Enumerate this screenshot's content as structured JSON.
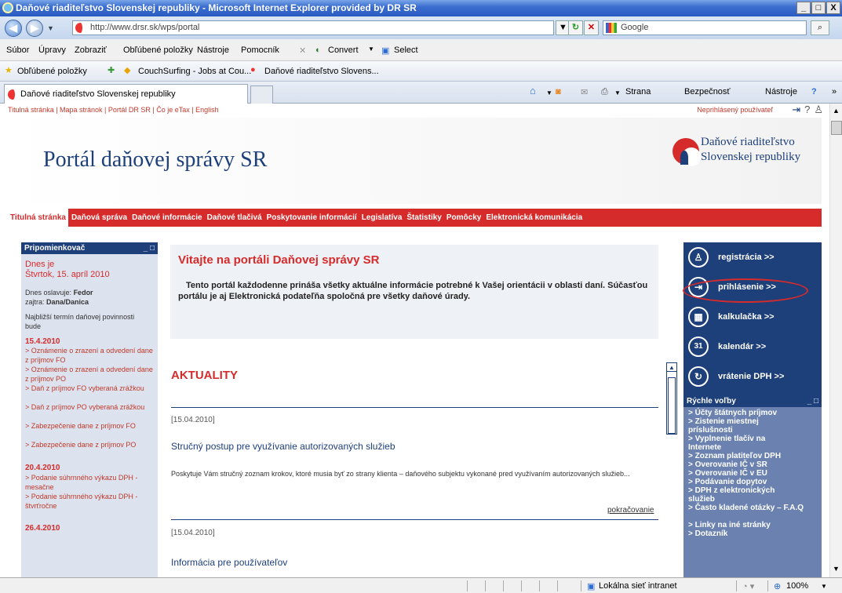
{
  "window": {
    "title": "Daňové riaditeľstvo Slovenskej republiky - Microsoft Internet Explorer provided by DR SR",
    "controls": [
      "_",
      "□",
      "X"
    ]
  },
  "address": {
    "url": "http://www.drsr.sk/wps/portal",
    "search_placeholder": "Google"
  },
  "menu": {
    "items": [
      "Súbor",
      "Úpravy",
      "Zobraziť",
      "Obľúbené položky",
      "Nástroje",
      "Pomocník"
    ],
    "convert": "Convert",
    "select": "Select"
  },
  "favorites": {
    "label": "Obľúbené položky",
    "links": [
      "CouchSurfing - Jobs at Cou...",
      "Daňové riaditeľstvo Slovens..."
    ]
  },
  "tab": {
    "title": "Daňové riaditeľstvo Slovenskej republiky"
  },
  "commands": [
    "Strana",
    "Bezpečnosť",
    "Nástroje"
  ],
  "page": {
    "toplinks": "Titulná stránka | Mapa stránok | Portál DR SR | Čo je eTax | English",
    "unsigned": "Neprihlásený používateľ",
    "portal_title": "Portál daňovej správy SR",
    "org_line1": "Daňové riaditeľstvo",
    "org_line2": "Slovenskej republiky",
    "nav": [
      "Titulná stránka",
      "Daňová správa",
      "Daňové informácie",
      "Daňové tlačivá",
      "Poskytovanie informácií",
      "Legislatíva",
      "Štatistiky",
      "Pomôcky",
      "Elektronická komunikácia"
    ],
    "left": {
      "header": "Pripomienkovač",
      "today": "Dnes je",
      "date": "Štvrtok, 15. apríl 2010",
      "namesday": "Dnes oslavuje:",
      "namesday_name": "Fedor",
      "tomorrow": "zajtra:",
      "tomorrow_name": "Dana/Danica",
      "deadline": "Najbližší termín daňovej povinnosti bude",
      "d1": "15.4.2010",
      "d1_items": [
        "> Oznámenie o zrazení a odvedení dane z príjmov FO",
        "> Oznámenie o zrazení a odvedení dane z príjmov PO",
        "> Daň z príjmov FO vyberaná zrážkou",
        "> Daň z príjmov PO vyberaná zrážkou",
        "> Zabezpečenie dane z príjmov FO",
        "> Zabezpečenie dane z príjmov PO"
      ],
      "d2": "20.4.2010",
      "d2_items": [
        "> Podanie súhrnného výkazu DPH - mesačne",
        "> Podanie súhrnného výkazu DPH - štvrťročne"
      ],
      "d3": "26.4.2010"
    },
    "welcome_title": "Vitajte na portáli Daňovej správy SR",
    "welcome_text": "Tento portál každodenne prináša všetky aktuálne informácie potrebné k Vašej orientácii v oblasti daní. Súčasťou portálu je aj Elektronická podateľňa spoločná pre všetky daňové úrady.",
    "news_heading": "AKTUALITY",
    "news": [
      {
        "date": "[15.04.2010]",
        "title": "Stručný postup pre využívanie autorizovaných služieb",
        "body": "Poskytuje Vám stručný zoznam krokov, ktoré musia byť zo strany klienta – daňového subjektu vykonané pred využívaním autorizovaných služieb...",
        "more": "pokračovanie"
      },
      {
        "date": "[15.04.2010]",
        "title": "Informácia pre používateľov"
      }
    ],
    "right": [
      {
        "label": "registrácia >>",
        "icon": "person-icon"
      },
      {
        "label": "prihlásenie >>",
        "icon": "login-icon"
      },
      {
        "label": "kalkulačka >>",
        "icon": "calculator-icon"
      },
      {
        "label": "kalendár >>",
        "icon": "calendar-icon",
        "badge": "31"
      },
      {
        "label": "vrátenie DPH >>",
        "icon": "refresh-icon"
      }
    ],
    "quick": {
      "header": "Rýchle voľby",
      "links": [
        "> Účty štátnych príjmov",
        "> Zistenie miestnej príslušnosti",
        "> Vyplnenie tlačív na Internete",
        "> Zoznam platiteľov DPH",
        "> Overovanie IČ v SR",
        "> Overovanie IČ v EU",
        "> Podávanie dopytov",
        "> DPH z elektronických služieb",
        "> Často kladené otázky – F.A.Q",
        "> Linky na iné stránky",
        "> Dotazník"
      ]
    }
  },
  "status": {
    "zone": "Lokálna sieť intranet",
    "zoom": "100%"
  },
  "colors": {
    "accent_red": "#d62b2b",
    "navy": "#1d3f7a"
  }
}
